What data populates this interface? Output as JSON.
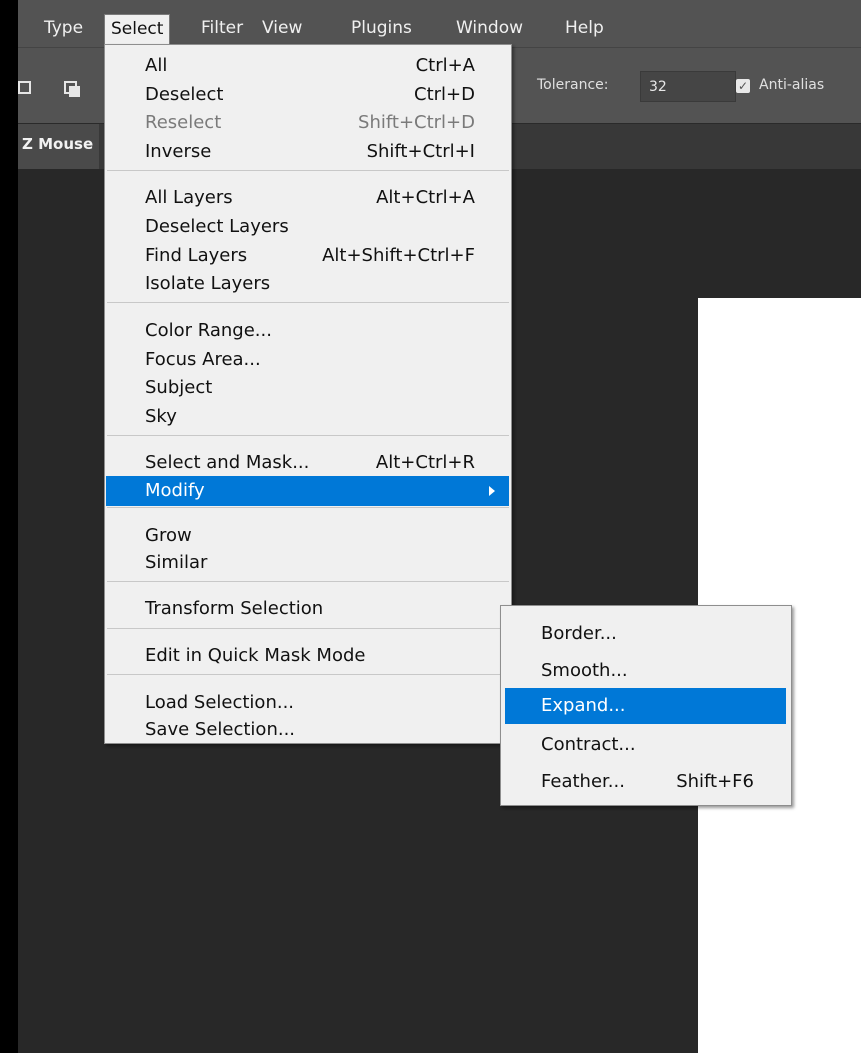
{
  "menubar": {
    "items": [
      {
        "label": "Type"
      },
      {
        "label": "Select"
      },
      {
        "label": "Filter"
      },
      {
        "label": "View"
      },
      {
        "label": "Plugins"
      },
      {
        "label": "Window"
      },
      {
        "label": "Help"
      }
    ]
  },
  "options": {
    "tolerance_label": "Tolerance:",
    "tolerance_value": "32",
    "antialias_label": "Anti-alias",
    "antialias_checked": true
  },
  "document_tab": {
    "label": "Z Mouse"
  },
  "select_menu": {
    "items": [
      {
        "label": "All",
        "shortcut": "Ctrl+A"
      },
      {
        "label": "Deselect",
        "shortcut": "Ctrl+D"
      },
      {
        "label": "Reselect",
        "shortcut": "Shift+Ctrl+D",
        "disabled": true
      },
      {
        "label": "Inverse",
        "shortcut": "Shift+Ctrl+I"
      },
      {
        "label": "All Layers",
        "shortcut": "Alt+Ctrl+A"
      },
      {
        "label": "Deselect Layers",
        "shortcut": ""
      },
      {
        "label": "Find Layers",
        "shortcut": "Alt+Shift+Ctrl+F"
      },
      {
        "label": "Isolate Layers",
        "shortcut": ""
      },
      {
        "label": "Color Range...",
        "shortcut": ""
      },
      {
        "label": "Focus Area...",
        "shortcut": ""
      },
      {
        "label": "Subject",
        "shortcut": ""
      },
      {
        "label": "Sky",
        "shortcut": ""
      },
      {
        "label": "Select and Mask...",
        "shortcut": "Alt+Ctrl+R"
      },
      {
        "label": "Modify",
        "shortcut": "",
        "highlighted": true,
        "has_submenu": true
      },
      {
        "label": "Grow",
        "shortcut": ""
      },
      {
        "label": "Similar",
        "shortcut": ""
      },
      {
        "label": "Transform Selection",
        "shortcut": ""
      },
      {
        "label": "Edit in Quick Mask Mode",
        "shortcut": ""
      },
      {
        "label": "Load Selection...",
        "shortcut": ""
      },
      {
        "label": "Save Selection...",
        "shortcut": ""
      }
    ]
  },
  "modify_submenu": {
    "items": [
      {
        "label": "Border...",
        "shortcut": ""
      },
      {
        "label": "Smooth...",
        "shortcut": ""
      },
      {
        "label": "Expand...",
        "shortcut": "",
        "highlighted": true
      },
      {
        "label": "Contract...",
        "shortcut": ""
      },
      {
        "label": "Feather...",
        "shortcut": "Shift+F6"
      }
    ]
  },
  "colors": {
    "menubar_bg": "#535353",
    "workspace_bg": "#282828",
    "menu_bg": "#f0f0f0",
    "highlight": "#0078d7"
  }
}
